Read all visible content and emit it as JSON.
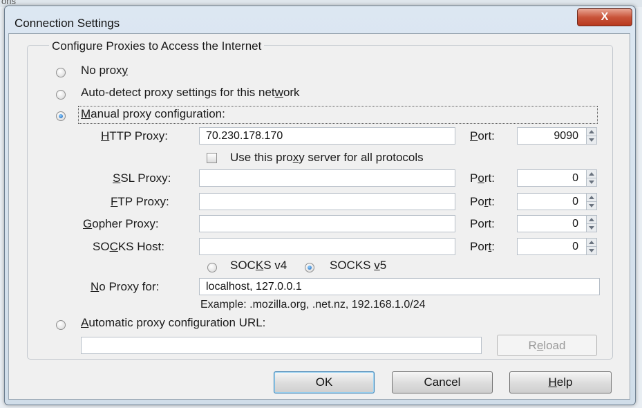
{
  "background_fragment": "ons",
  "window": {
    "title": "Connection Settings",
    "close_glyph": "X"
  },
  "group": {
    "legend": "Configure Proxies to Access the Internet"
  },
  "options": {
    "no_proxy": {
      "pre": "No prox",
      "key": "y",
      "post": "",
      "checked": false
    },
    "auto_detect": {
      "pre": "Auto-detect proxy settings for this net",
      "key": "w",
      "post": "ork",
      "checked": false
    },
    "manual": {
      "pre": "",
      "key": "M",
      "post": "anual proxy configuration:",
      "checked": true
    },
    "auto_url": {
      "pre": "",
      "key": "A",
      "post": "utomatic proxy configuration URL:",
      "checked": false
    }
  },
  "proxies": [
    {
      "id": "http",
      "label_pre": "",
      "label_key": "H",
      "label_post": "TTP Proxy:",
      "value": "70.230.178.170",
      "port_pre": "",
      "port_key": "P",
      "port_post": "ort:",
      "port": "9090"
    },
    {
      "id": "ssl",
      "label_pre": "",
      "label_key": "S",
      "label_post": "SL Proxy:",
      "value": "",
      "port_pre": "P",
      "port_key": "o",
      "port_post": "rt:",
      "port": "0"
    },
    {
      "id": "ftp",
      "label_pre": "",
      "label_key": "F",
      "label_post": "TP Proxy:",
      "value": "",
      "port_pre": "Po",
      "port_key": "r",
      "port_post": "t:",
      "port": "0"
    },
    {
      "id": "gopher",
      "label_pre": "",
      "label_key": "G",
      "label_post": "opher Proxy:",
      "value": "",
      "port_pre": "Port:",
      "port_key": "",
      "port_post": "",
      "port": "0"
    },
    {
      "id": "socks",
      "label_pre": "SO",
      "label_key": "C",
      "label_post": "KS Host:",
      "value": "",
      "port_pre": "Por",
      "port_key": "t",
      "port_post": ":",
      "port": "0"
    }
  ],
  "share_all": {
    "pre": "Use this pro",
    "key": "x",
    "post": "y server for all protocols",
    "checked": false
  },
  "socks_version": {
    "v4": {
      "pre": "SOC",
      "key": "K",
      "post": "S v4",
      "checked": false
    },
    "v5": {
      "pre": "SOCKS ",
      "key": "v",
      "post": "5",
      "checked": true
    }
  },
  "no_proxy_for": {
    "label_pre": "",
    "label_key": "N",
    "label_post": "o Proxy for:",
    "value": "localhost, 127.0.0.1",
    "example": "Example: .mozilla.org, .net.nz, 192.168.1.0/24"
  },
  "auto_url_value": "",
  "buttons": {
    "reload": {
      "pre": "R",
      "key": "e",
      "post": "load"
    },
    "ok": "OK",
    "cancel": "Cancel",
    "help": {
      "pre": "",
      "key": "H",
      "post": "elp"
    }
  }
}
